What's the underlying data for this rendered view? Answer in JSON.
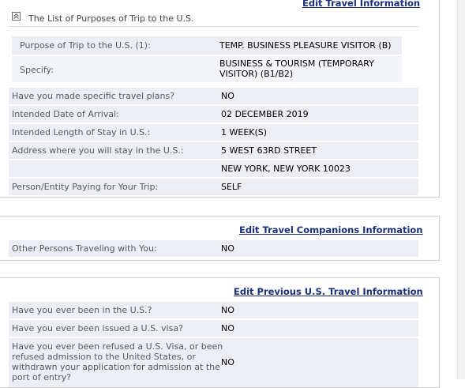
{
  "travel": {
    "edit_link": "Edit Travel Information",
    "list_title": "The List of Purposes of Trip to the U.S.",
    "purpose_label": "Purpose of Trip to the U.S. (1):",
    "purpose_value": "TEMP. BUSINESS PLEASURE VISITOR (B)",
    "specify_label": "Specify:",
    "specify_value": "BUSINESS & TOURISM (TEMPORARY VISITOR) (B1/B2)",
    "rows": [
      {
        "label": "Have you made specific travel plans?",
        "value": "NO"
      },
      {
        "label": "Intended Date of Arrival:",
        "value": "02 DECEMBER 2019"
      },
      {
        "label": "Intended Length of Stay in U.S.:",
        "value": "1 WEEK(S)"
      },
      {
        "label": "Address where you will stay in the U.S.:",
        "value": "5 WEST 63RD STREET"
      },
      {
        "label": "",
        "value": "NEW YORK, NEW YORK 10023"
      },
      {
        "label": "Person/Entity Paying for Your Trip:",
        "value": "SELF"
      }
    ]
  },
  "companions": {
    "edit_link": "Edit Travel Companions Information",
    "rows": [
      {
        "label": "Other Persons Traveling with You:",
        "value": "NO"
      }
    ]
  },
  "previous": {
    "edit_link": "Edit Previous U.S. Travel Information",
    "rows": [
      {
        "label": "Have you ever been in the U.S.?",
        "value": "NO"
      },
      {
        "label": "Have you ever been issued a U.S. visa?",
        "value": "NO"
      },
      {
        "label": "Have you ever been refused a U.S. Visa, or been refused admission to the United States, or withdrawn your application for admission at the port of entry?",
        "value": "NO"
      }
    ]
  },
  "icons": {
    "collapse": "collapse-up-icon"
  }
}
